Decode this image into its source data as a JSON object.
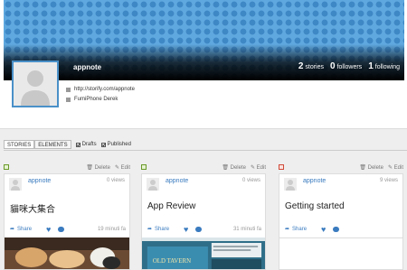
{
  "profile": {
    "username": "appnote",
    "stats": [
      {
        "num": "2",
        "label": "stories"
      },
      {
        "num": "0",
        "label": "followers"
      },
      {
        "num": "1",
        "label": "following"
      }
    ],
    "url": "http://storify.com/appnote",
    "facebook": "FumiPhone Derek"
  },
  "tabs": {
    "stories": "STORIES",
    "elements": "ELEMENTS",
    "drafts": "Drafts",
    "published": "Published"
  },
  "actions": {
    "delete": "Delete",
    "edit": "Edit"
  },
  "cards": [
    {
      "user": "appnote",
      "views": "0 views",
      "title": "貓咪大集合",
      "share": "Share",
      "time": "19 minuti fa",
      "status": "published"
    },
    {
      "user": "appnote",
      "views": "0 views",
      "title": "App Review",
      "share": "Share",
      "time": "31 minuti fa",
      "status": "published",
      "thumb_text": "OLD TAVERN"
    },
    {
      "user": "appnote",
      "views": "9 views",
      "title": "Getting started",
      "share": "Share",
      "time": "",
      "status": "draft"
    }
  ]
}
